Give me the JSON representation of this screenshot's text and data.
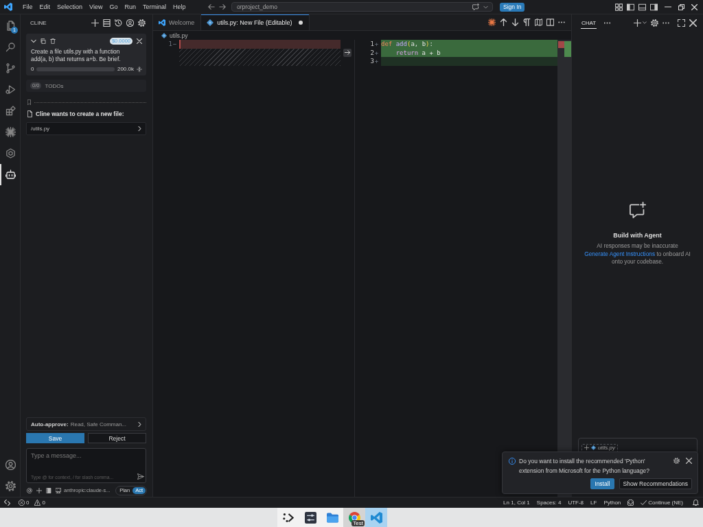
{
  "title_bar": {
    "menu": [
      "File",
      "Edit",
      "Selection",
      "View",
      "Go",
      "Run",
      "Terminal",
      "Help"
    ],
    "command_center": "orproject_demo",
    "sign_in": "Sign In"
  },
  "activity_bar": [
    {
      "selected": false,
      "badge": "1"
    },
    {
      "selected": false
    },
    {
      "selected": false
    },
    {
      "selected": false
    },
    {
      "selected": false
    },
    {
      "selected": false
    },
    {
      "selected": false
    },
    {
      "selected": true
    }
  ],
  "cline": {
    "title": "CLINE",
    "task": {
      "cost": "$0.0000",
      "text": "Create a file utils.py with a function add(a, b) that returns a+b. Be brief.",
      "tokens_used": "0",
      "level": 0,
      "token_limit": "200.0k"
    },
    "todos": {
      "count": "0/0",
      "label": "TODOs"
    },
    "request": {
      "title": "Cline wants to create a new file:",
      "file": "/utils.py"
    },
    "auto_approve": {
      "label": "Auto-approve:",
      "value": "Read, Safe Comman..."
    },
    "actions": [
      {
        "label": "Save",
        "kind": "primary"
      },
      {
        "label": "Reject",
        "kind": "secondary"
      }
    ],
    "message": {
      "placeholder": "Type a message...",
      "hint": "Type @ for context, / for slash comma..."
    },
    "model": "anthropic:claude-s...",
    "modes": [
      {
        "label": "Plan",
        "selected": false
      },
      {
        "label": "Act",
        "selected": true
      }
    ]
  },
  "editor": {
    "tabs": [
      {
        "label": "Welcome",
        "kind": "page",
        "selected": false,
        "modified": false
      },
      {
        "label": "utils.py: New File (Editable)",
        "kind": "file",
        "selected": true,
        "modified": true
      }
    ],
    "breadcrumb": "utils.py",
    "diff": {
      "original": [
        {
          "number": "1",
          "marker": "−"
        }
      ],
      "modified": [
        {
          "number": "1",
          "marker": "+",
          "tokens": [
            {
              "text": "def ",
              "kind": "keyword"
            },
            {
              "text": "add",
              "kind": "function"
            },
            {
              "text": "(",
              "kind": "bracket"
            },
            {
              "text": "a, b",
              "kind": "plain"
            },
            {
              "text": ")",
              "kind": "bracket"
            },
            {
              "text": ":",
              "kind": "plain"
            }
          ]
        },
        {
          "number": "2",
          "marker": "+",
          "tokens": [
            {
              "text": "    return",
              "kind": "control"
            },
            {
              "text": " a + b",
              "kind": "plain"
            }
          ]
        },
        {
          "number": "3",
          "marker": "+"
        }
      ]
    }
  },
  "chat": {
    "tab": {
      "label": "CHAT",
      "selected": true
    },
    "heading": "Build with Agent",
    "disclaimer": "AI responses may be inaccurate",
    "onboarding": {
      "link": "Generate Agent Instructions",
      "text": "to onboard AI onto your codebase."
    },
    "context_chip": "utils.py"
  },
  "notification": {
    "message": "Do you want to install the recommended 'Python' extension from Microsoft for the Python language?",
    "buttons": [
      {
        "label": "Install",
        "kind": "primary"
      },
      {
        "label": "Show Recommendations",
        "kind": "secondary"
      }
    ]
  },
  "status_bar": {
    "errors": "0",
    "warnings": "0",
    "items": [
      "Ln 1, Col 1",
      "Spaces: 4",
      "UTF-8",
      "LF",
      "Python"
    ],
    "continue": "Continue (NE)"
  },
  "taskbar": [
    {
      "selected": false,
      "hovered": false
    },
    {
      "selected": false,
      "hovered": false
    },
    {
      "selected": false,
      "hovered": false
    },
    {
      "selected": false,
      "hovered": true,
      "badge": "Test"
    },
    {
      "selected": true,
      "hovered": false
    }
  ]
}
